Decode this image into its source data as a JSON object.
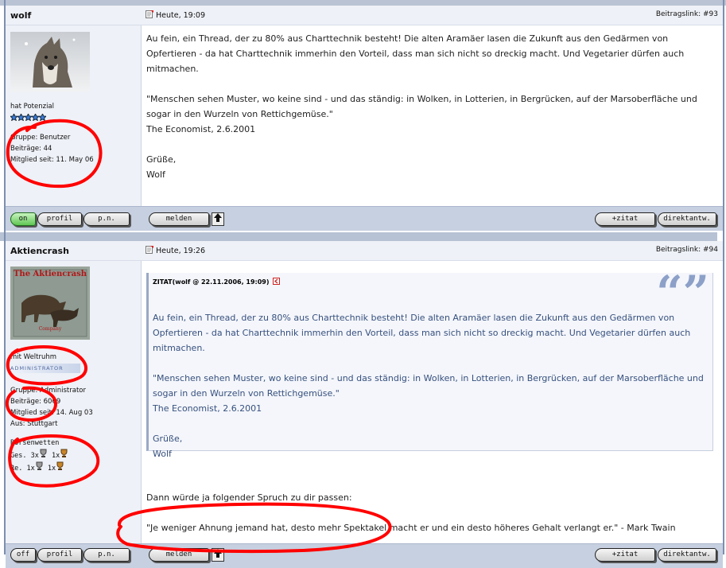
{
  "posts": [
    {
      "author": "wolf",
      "date": "Heute, 19:09",
      "post_link": "Beitragslink: #93",
      "rank": "hat Potenzial",
      "group": "Gruppe: Benutzer",
      "posts_count": "Beiträge: 44",
      "member_since": "Mitglied seit: 11. May 06",
      "message": [
        "Au fein, ein Thread, der zu 80% aus Charttechnik besteht! Die alten Aramäer lasen die Zukunft aus den Gedärmen von Opfertieren - da hat Charttechnik immerhin den Vorteil, dass man sich nicht so dreckig macht. Und Vegetarier dürfen auch mitmachen.",
        "\"Menschen sehen Muster, wo keine sind - und das ständig: in Wolken, in Lotterien, in Bergrücken, auf der Marsoberfläche und sogar in den Wurzeln von Rettichgemüse.\"",
        "The Economist, 2.6.2001",
        "Grüße,",
        "Wolf"
      ],
      "buttons": {
        "status": "on",
        "profile": "profil",
        "pm": "p.n.",
        "report": "melden",
        "quote": "+zitat",
        "direct": "direktantw."
      }
    },
    {
      "author": "Aktiencrash",
      "date": "Heute, 19:26",
      "post_link": "Beitragslink: #94",
      "avatar_text": {
        "title": "The Aktiencrash",
        "bottom": "Company"
      },
      "rank": "mit Weltruhm",
      "role_badge": "ADMINISTRATOR",
      "group": "Gruppe: Administrator",
      "posts_count": "Beiträge: 6069",
      "member_since": "Mitglied seit: 14. Aug 03",
      "location": "Aus: Stuttgart",
      "awards_title": "Börsenwetten",
      "awards_ges": "Ges. 3x",
      "awards_ges2": "1x",
      "awards_re": "Re. 1x",
      "awards_re2": "1x",
      "quote_header": "ZITAT(wolf @ 22.11.2006, 19:09)",
      "quote": [
        "Au fein, ein Thread, der zu 80% aus Charttechnik besteht! Die alten Aramäer lasen die Zukunft aus den Gedärmen von Opfertieren - da hat Charttechnik immerhin den Vorteil, dass man sich nicht so dreckig macht. Und Vegetarier dürfen auch mitmachen.",
        "\"Menschen sehen Muster, wo keine sind - und das ständig: in Wolken, in Lotterien, in Bergrücken, auf der Marsoberfläche und sogar in den Wurzeln von Rettichgemüse.\"",
        "The Economist, 2.6.2001",
        "Grüße,",
        "Wolf"
      ],
      "reply_1": "Dann würde ja folgender Spruch zu dir passen:",
      "reply_2": "\"Je weniger Ahnung jemand hat, desto mehr Spektakel macht er und ein desto höheres Gehalt verlangt er.\" - Mark Twain",
      "buttons": {
        "status": "off",
        "profile": "profil",
        "pm": "p.n.",
        "report": "melden",
        "quote": "+zitat",
        "direct": "direktantw."
      }
    }
  ],
  "colors": {
    "annotation": "#ff0000",
    "header_bg": "#eef1f7",
    "footer_bg": "#c6d0e0",
    "quote_text": "#37507e"
  },
  "icons": [
    "post-icon",
    "star-icon",
    "up-arrow-icon",
    "quote-marks-icon",
    "trophy-icon",
    "goto-post-icon"
  ]
}
